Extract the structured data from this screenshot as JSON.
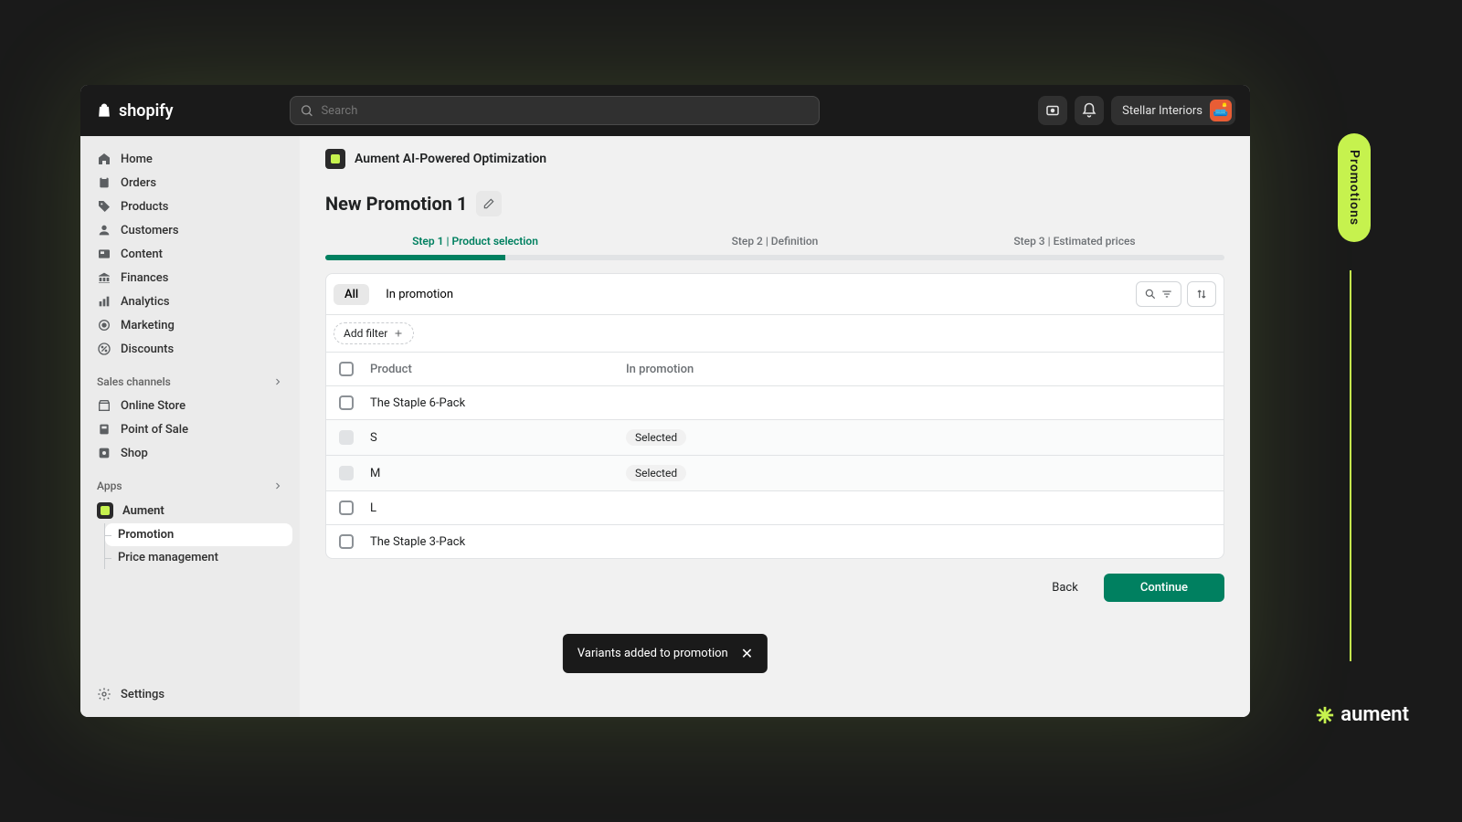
{
  "topbar": {
    "logo_text": "shopify",
    "search_placeholder": "Search",
    "store_name": "Stellar Interiors",
    "avatar_emoji": "🛋️"
  },
  "sidebar": {
    "items": [
      {
        "label": "Home",
        "icon": "home"
      },
      {
        "label": "Orders",
        "icon": "orders"
      },
      {
        "label": "Products",
        "icon": "tag"
      },
      {
        "label": "Customers",
        "icon": "person"
      },
      {
        "label": "Content",
        "icon": "content"
      },
      {
        "label": "Finances",
        "icon": "bank"
      },
      {
        "label": "Analytics",
        "icon": "chart"
      },
      {
        "label": "Marketing",
        "icon": "target"
      },
      {
        "label": "Discounts",
        "icon": "discount"
      }
    ],
    "sales_channels_label": "Sales channels",
    "channels": [
      {
        "label": "Online Store",
        "icon": "store"
      },
      {
        "label": "Point of Sale",
        "icon": "pos"
      },
      {
        "label": "Shop",
        "icon": "shop"
      }
    ],
    "apps_label": "Apps",
    "apps": [
      {
        "label": "Aument"
      },
      {
        "label": "Promotion",
        "active": true
      },
      {
        "label": "Price management"
      }
    ],
    "settings_label": "Settings"
  },
  "main": {
    "app_name": "Aument AI-Powered Optimization",
    "page_title": "New Promotion 1",
    "steps": [
      {
        "label": "Step 1 | Product selection",
        "active": true
      },
      {
        "label": "Step 2 | Definition"
      },
      {
        "label": "Step 3 | Estimated prices"
      }
    ],
    "tabs": {
      "all": "All",
      "in_promotion": "In promotion"
    },
    "add_filter": "Add filter",
    "columns": {
      "product": "Product",
      "in_promotion": "In promotion"
    },
    "rows": [
      {
        "name": "The Staple 6-Pack",
        "type": "product",
        "checked": false
      },
      {
        "name": "S",
        "type": "variant",
        "selected": true
      },
      {
        "name": "M",
        "type": "variant",
        "selected": true
      },
      {
        "name": "L",
        "type": "variant",
        "checked": false
      },
      {
        "name": "The Staple 3-Pack",
        "type": "product",
        "checked": false
      }
    ],
    "selected_badge": "Selected",
    "back": "Back",
    "continue": "Continue",
    "toast": "Variants added to promotion"
  },
  "decor": {
    "promo_tab": "Promotions",
    "brand": "aument"
  }
}
